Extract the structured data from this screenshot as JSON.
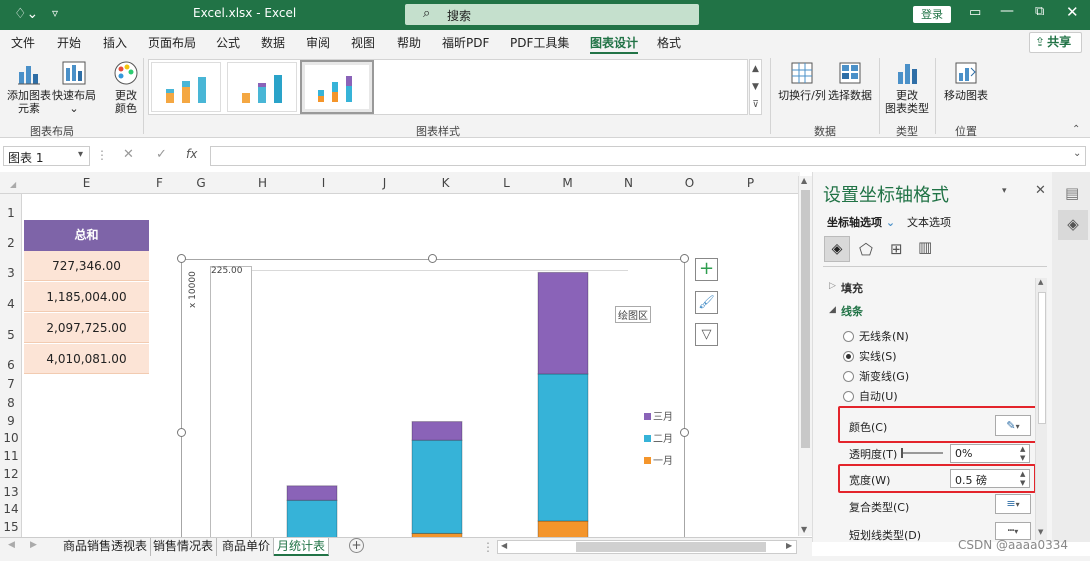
{
  "title": {
    "file": "Excel.xlsx",
    "sep": "-",
    "app": "Excel",
    "search": "搜索",
    "login": "登录"
  },
  "ribbon_tabs": [
    "文件",
    "开始",
    "插入",
    "页面布局",
    "公式",
    "数据",
    "审阅",
    "视图",
    "帮助",
    "福昕PDF",
    "PDF工具集",
    "图表设计",
    "格式"
  ],
  "active_tab": "图表设计",
  "share": "共享",
  "ribbon": {
    "add_chart_element": "添加图表\n元素",
    "quick_layout": "快速布局",
    "change_colors": "更改\n颜色",
    "layout_group": "图表布局",
    "styles_group": "图表样式",
    "switch_row_col": "切换行/列",
    "select_data": "选择数据",
    "data_group": "数据",
    "change_type": "更改\n图表类型",
    "type_group": "类型",
    "move_chart": "移动图表",
    "location_group": "位置"
  },
  "namebox": "图表 1",
  "fx": "fx",
  "columns": [
    "E",
    "F",
    "G",
    "H",
    "I",
    "J",
    "K",
    "L",
    "M",
    "N",
    "O",
    "P"
  ],
  "rows": [
    "1",
    "2",
    "3",
    "4",
    "5",
    "6",
    "7",
    "8",
    "9",
    "10",
    "11",
    "12",
    "13",
    "14",
    "15"
  ],
  "cells": {
    "header": "总和",
    "values": [
      "727,346.00",
      "1,185,004.00",
      "2,097,725.00",
      "4,010,081.00"
    ]
  },
  "chart": {
    "axis_unit": "x 10000",
    "axis_label": "225.00",
    "plot_area_tooltip": "绘图区",
    "legend": [
      "三月",
      "二月",
      "一月"
    ]
  },
  "chart_data": {
    "type": "bar",
    "stacked": true,
    "categories": [
      "",
      "",
      ""
    ],
    "series": [
      {
        "name": "一月",
        "color": "#f4952b",
        "values": [
          10,
          16,
          28
        ]
      },
      {
        "name": "二月",
        "color": "#36b3d8",
        "values": [
          38,
          90,
          142
        ]
      },
      {
        "name": "三月",
        "color": "#8a63b8",
        "values": [
          14,
          18,
          98
        ]
      }
    ],
    "ylim": [
      0,
      280
    ]
  },
  "pane": {
    "title": "设置坐标轴格式",
    "axis_options": "坐标轴选项",
    "text_options": "文本选项",
    "fill": "填充",
    "line": "线条",
    "no_line": "无线条(N)",
    "solid_line": "实线(S)",
    "gradient_line": "渐变线(G)",
    "auto": "自动(U)",
    "color": "颜色(C)",
    "transparency": "透明度(T)",
    "transparency_value": "0%",
    "width": "宽度(W)",
    "width_value": "0.5 磅",
    "compound": "复合类型(C)",
    "dash": "短划线类型(D)"
  },
  "sheet_tabs": [
    "商品销售透视表",
    "销售情况表",
    "商品单价",
    "月统计表"
  ],
  "active_sheet": "月统计表",
  "watermark": "CSDN @aaaa0334",
  "status": "就绪"
}
